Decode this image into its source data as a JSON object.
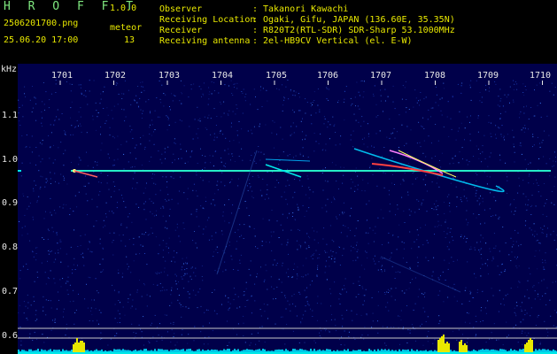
{
  "app": {
    "name": "H R O F F T",
    "version": "1.0.0"
  },
  "file_name": "2506201700.png",
  "timestamp": "25.06.20 17:00",
  "event": {
    "type": "meteor",
    "count": "13"
  },
  "info": [
    {
      "label": "Observer",
      "value": "Takanori Kawachi"
    },
    {
      "label": "Receiving Location",
      "value": "Ogaki, Gifu, JAPAN (136.60E, 35.35N)"
    },
    {
      "label": "Receiver",
      "value": "R820T2(RTL-SDR) SDR-Sharp 53.1000MHz"
    },
    {
      "label": "Receiving antenna",
      "value": "2el-HB9CV Vertical (el. E-W)"
    }
  ],
  "axis": {
    "y_unit": "kHz",
    "y_ticks": [
      "1.1",
      "1.0",
      "0.9",
      "0.8",
      "0.7",
      "0.6"
    ],
    "x_ticks": [
      "1701",
      "1702",
      "1703",
      "1704",
      "1705",
      "1706",
      "1707",
      "1708",
      "1709",
      "1710"
    ]
  },
  "colors": {
    "background": "#00004a",
    "carrier": "#00e8e8",
    "activity": "#e8e800",
    "label": "#e8e800"
  }
}
